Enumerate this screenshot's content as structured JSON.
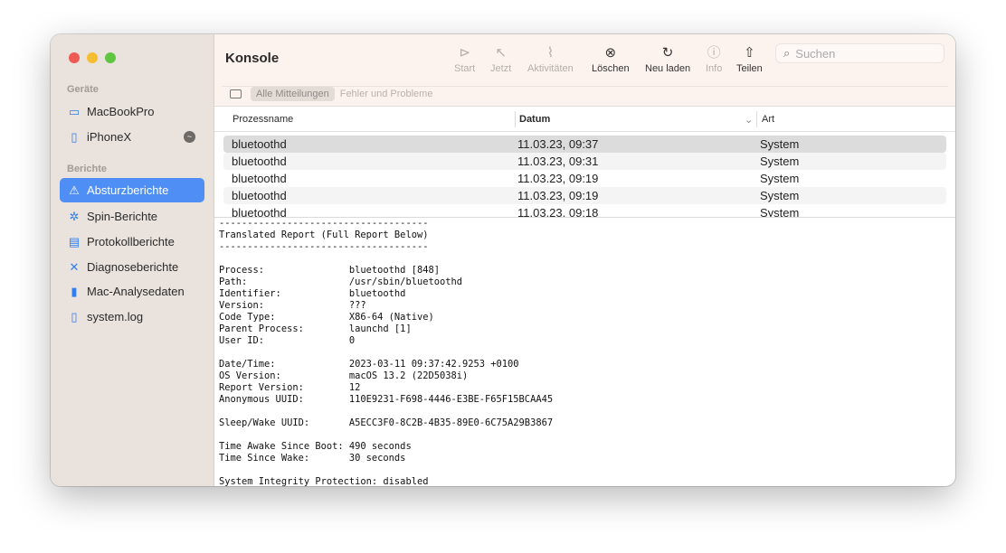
{
  "sidebar": {
    "devices_heading": "Geräte",
    "devices": [
      {
        "label": "MacBookPro",
        "icon": "laptop-icon"
      },
      {
        "label": "iPhoneX",
        "icon": "iphone-icon",
        "badge": "sync-icon"
      }
    ],
    "reports_heading": "Berichte",
    "reports": [
      {
        "label": "Absturzberichte",
        "icon": "warning-icon",
        "selected": true
      },
      {
        "label": "Spin-Berichte",
        "icon": "spin-icon"
      },
      {
        "label": "Protokollberichte",
        "icon": "document-icon"
      },
      {
        "label": "Diagnoseberichte",
        "icon": "tools-icon"
      },
      {
        "label": "Mac-Analysedaten",
        "icon": "chart-icon"
      },
      {
        "label": "system.log",
        "icon": "file-icon"
      }
    ]
  },
  "toolbar": {
    "title": "Konsole",
    "buttons": [
      {
        "label": "Start",
        "icon": "play-icon",
        "enabled": false
      },
      {
        "label": "Jetzt",
        "icon": "arrow-up-left-icon",
        "enabled": false
      },
      {
        "label": "Aktivitäten",
        "icon": "activity-icon",
        "enabled": false
      },
      {
        "label": "Löschen",
        "icon": "clear-icon",
        "enabled": true
      },
      {
        "label": "Neu laden",
        "icon": "reload-icon",
        "enabled": true
      },
      {
        "label": "Info",
        "icon": "info-icon",
        "enabled": false
      },
      {
        "label": "Teilen",
        "icon": "share-icon",
        "enabled": true
      }
    ],
    "search_placeholder": "Suchen",
    "filters": [
      "Alle Mitteilungen",
      "Fehler und Probleme"
    ]
  },
  "table": {
    "columns": [
      "Prozessname",
      "Datum",
      "Art"
    ],
    "rows": [
      [
        "bluetoothd",
        "11.03.23, 09:37",
        "System"
      ],
      [
        "bluetoothd",
        "11.03.23, 09:31",
        "System"
      ],
      [
        "bluetoothd",
        "11.03.23, 09:19",
        "System"
      ],
      [
        "bluetoothd",
        "11.03.23, 09:19",
        "System"
      ],
      [
        "bluetoothd",
        "11.03.23, 09:18",
        "System"
      ]
    ]
  },
  "report": "-------------------------------------\nTranslated Report (Full Report Below)\n-------------------------------------\n\nProcess:               bluetoothd [848]\nPath:                  /usr/sbin/bluetoothd\nIdentifier:            bluetoothd\nVersion:               ???\nCode Type:             X86-64 (Native)\nParent Process:        launchd [1]\nUser ID:               0\n\nDate/Time:             2023-03-11 09:37:42.9253 +0100\nOS Version:            macOS 13.2 (22D5038i)\nReport Version:        12\nAnonymous UUID:        110E9231-F698-4446-E3BE-F65F15BCAA45\n\nSleep/Wake UUID:       A5ECC3F0-8C2B-4B35-89E0-6C75A29B3867\n\nTime Awake Since Boot: 490 seconds\nTime Since Wake:       30 seconds\n\nSystem Integrity Protection: disabled"
}
